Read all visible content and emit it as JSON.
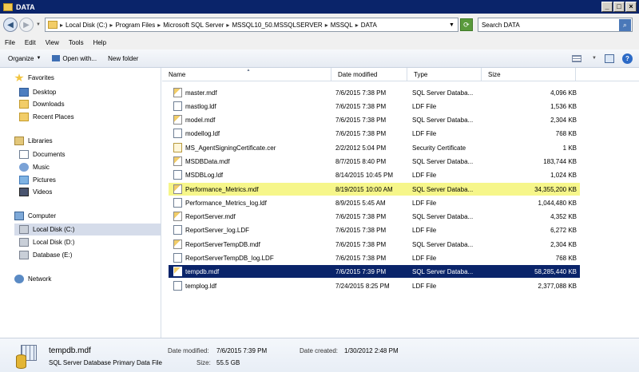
{
  "window": {
    "title": "DATA"
  },
  "address": {
    "segments": [
      "Local Disk (C:)",
      "Program Files",
      "Microsoft SQL Server",
      "MSSQL10_50.MSSQLSERVER",
      "MSSQL",
      "DATA"
    ]
  },
  "search": {
    "placeholder": "Search DATA"
  },
  "menu": [
    "File",
    "Edit",
    "View",
    "Tools",
    "Help"
  ],
  "toolbar": {
    "organize": "Organize",
    "open_with": "Open with...",
    "new_folder": "New folder"
  },
  "nav": {
    "favorites": {
      "label": "Favorites",
      "items": [
        "Desktop",
        "Downloads",
        "Recent Places"
      ]
    },
    "libraries": {
      "label": "Libraries",
      "items": [
        "Documents",
        "Music",
        "Pictures",
        "Videos"
      ]
    },
    "computer": {
      "label": "Computer",
      "items": [
        "Local Disk (C:)",
        "Local Disk (D:)",
        "Database (E:)"
      ]
    },
    "network": {
      "label": "Network"
    }
  },
  "columns": {
    "name": "Name",
    "date": "Date modified",
    "type": "Type",
    "size": "Size"
  },
  "files": [
    {
      "name": "master.mdf",
      "date": "7/6/2015 7:38 PM",
      "type": "SQL Server Databa...",
      "size": "4,096 KB"
    },
    {
      "name": "mastlog.ldf",
      "date": "7/6/2015 7:38 PM",
      "type": "LDF File",
      "size": "1,536 KB"
    },
    {
      "name": "model.mdf",
      "date": "7/6/2015 7:38 PM",
      "type": "SQL Server Databa...",
      "size": "2,304 KB"
    },
    {
      "name": "modellog.ldf",
      "date": "7/6/2015 7:38 PM",
      "type": "LDF File",
      "size": "768 KB"
    },
    {
      "name": "MS_AgentSigningCertificate.cer",
      "date": "2/2/2012 5:04 PM",
      "type": "Security Certificate",
      "size": "1 KB"
    },
    {
      "name": "MSDBData.mdf",
      "date": "8/7/2015 8:40 PM",
      "type": "SQL Server Databa...",
      "size": "183,744 KB"
    },
    {
      "name": "MSDBLog.ldf",
      "date": "8/14/2015 10:45 PM",
      "type": "LDF File",
      "size": "1,024 KB"
    },
    {
      "name": "Performance_Metrics.mdf",
      "date": "8/19/2015 10:00 AM",
      "type": "SQL Server Databa...",
      "size": "34,355,200 KB"
    },
    {
      "name": "Performance_Metrics_log.ldf",
      "date": "8/9/2015 5:45 AM",
      "type": "LDF File",
      "size": "1,044,480 KB"
    },
    {
      "name": "ReportServer.mdf",
      "date": "7/6/2015 7:38 PM",
      "type": "SQL Server Databa...",
      "size": "4,352 KB"
    },
    {
      "name": "ReportServer_log.LDF",
      "date": "7/6/2015 7:38 PM",
      "type": "LDF File",
      "size": "6,272 KB"
    },
    {
      "name": "ReportServerTempDB.mdf",
      "date": "7/6/2015 7:38 PM",
      "type": "SQL Server Databa...",
      "size": "2,304 KB"
    },
    {
      "name": "ReportServerTempDB_log.LDF",
      "date": "7/6/2015 7:38 PM",
      "type": "LDF File",
      "size": "768 KB"
    },
    {
      "name": "tempdb.mdf",
      "date": "7/6/2015 7:39 PM",
      "type": "SQL Server Databa...",
      "size": "58,285,440 KB"
    },
    {
      "name": "templog.ldf",
      "date": "7/24/2015 8:25 PM",
      "type": "LDF File",
      "size": "2,377,088 KB"
    }
  ],
  "details": {
    "name": "tempdb.mdf",
    "type": "SQL Server Database Primary Data File",
    "modified_label": "Date modified:",
    "modified": "7/6/2015 7:39 PM",
    "created_label": "Date created:",
    "created": "1/30/2012 2:48 PM",
    "size_label": "Size:",
    "size": "55.5 GB"
  },
  "colors": {
    "selection": "#0a246a",
    "highlight": "#f6f68a",
    "titlebar": "#0a246a"
  }
}
